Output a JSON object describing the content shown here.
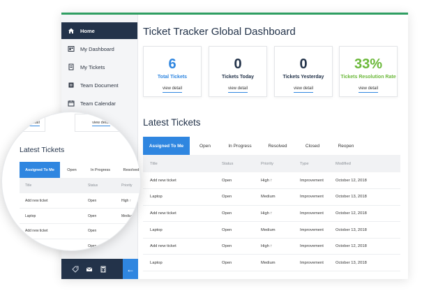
{
  "colors": {
    "navy": "#23334a",
    "accent_blue": "#2f86e0",
    "green": "#6bb83a",
    "status_open": "#2f86e0",
    "priority_high": "#e23a3a",
    "priority_medium": "#f5a623",
    "top_border": "#2f9e62"
  },
  "sidebar": {
    "items": [
      {
        "label": "Home",
        "icon": "home-icon",
        "active": true
      },
      {
        "label": "My Dashboard",
        "icon": "dashboard-icon",
        "active": false
      },
      {
        "label": "My Tickets",
        "icon": "tickets-icon",
        "active": false
      },
      {
        "label": "Team Document",
        "icon": "document-icon",
        "active": false
      },
      {
        "label": "Team Calendar",
        "icon": "calendar-icon",
        "active": false
      }
    ],
    "footer_icons": [
      "tag-icon",
      "mail-icon",
      "calculator-icon"
    ],
    "collapse_arrow": "←"
  },
  "main": {
    "title": "Ticket Tracker Global Dashboard",
    "cards": [
      {
        "value": "6",
        "label": "Total Tickets",
        "link": "view detail",
        "color": "#2f86e0"
      },
      {
        "value": "0",
        "label": "Tickets Today",
        "link": "view detail",
        "color": "#23334a"
      },
      {
        "value": "0",
        "label": "Tickets Yesterday",
        "link": "view detail",
        "color": "#23334a"
      },
      {
        "value": "33%",
        "label": "Tickets Resolution Rate",
        "link": "view detail",
        "color": "#6bb83a"
      }
    ],
    "latest_title": "Latest Tickets",
    "tabs": [
      "Assigned To Me",
      "Open",
      "In Progress",
      "Resolved",
      "Closed",
      "Reopen"
    ],
    "columns": [
      "Title",
      "Status",
      "Priority",
      "Type",
      "Modified"
    ],
    "rows": [
      {
        "title": "Add new ticket",
        "status": "Open",
        "priority": "High ↑",
        "type": "Improvement",
        "modified": "October 12, 2018"
      },
      {
        "title": "Laptop",
        "status": "Open",
        "priority": "Medium",
        "type": "Improvement",
        "modified": "October 13, 2018"
      },
      {
        "title": "Add new ticket",
        "status": "Open",
        "priority": "High ↑",
        "type": "Improvement",
        "modified": "October 12, 2018"
      },
      {
        "title": "Laptop",
        "status": "Open",
        "priority": "Medium",
        "type": "Improvement",
        "modified": "October 13, 2018"
      },
      {
        "title": "Add new ticket",
        "status": "Open",
        "priority": "High ↑",
        "type": "Improvement",
        "modified": "October 12, 2018"
      },
      {
        "title": "Laptop",
        "status": "Open",
        "priority": "Medium",
        "type": "Improvement",
        "modified": "October 13, 2018"
      }
    ]
  },
  "magnifier": {
    "card_links": [
      "view detail",
      "view detail"
    ],
    "title": "Latest Tickets",
    "tabs": [
      "Assigned To Me",
      "Open",
      "In Progress",
      "Resolved"
    ],
    "columns": [
      "Title",
      "Status",
      "Priority"
    ],
    "rows": [
      {
        "title": "Add new ticket",
        "status": "Open",
        "priority": "High ↑"
      },
      {
        "title": "Laptop",
        "status": "Open",
        "priority": "Medium"
      },
      {
        "title": "Add new ticket",
        "status": "Open",
        "priority": "High ↑"
      },
      {
        "title": "",
        "status": "Open",
        "priority": ""
      }
    ]
  }
}
